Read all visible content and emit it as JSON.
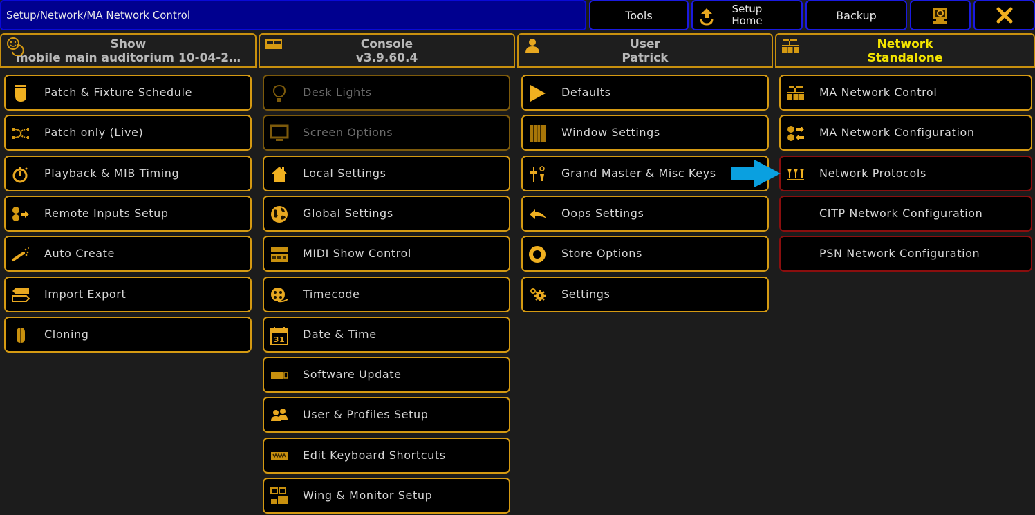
{
  "title_bar": {
    "path": "Setup/Network/MA Network Control"
  },
  "top_buttons": {
    "tools": "Tools",
    "setup_home_line1": "Setup",
    "setup_home_line2": "Home",
    "backup": "Backup",
    "screen_icon": "screen-capture-icon",
    "close_icon": "close-icon"
  },
  "headers": [
    {
      "title": "Show",
      "value": "mobile main auditorium 10-04-2…",
      "icon": "masks-icon",
      "active": false
    },
    {
      "title": "Console",
      "value": "v3.9.60.4",
      "icon": "console-icon",
      "active": false
    },
    {
      "title": "User",
      "value": "Patrick",
      "icon": "user-icon",
      "active": false
    },
    {
      "title": "Network",
      "value": "Standalone",
      "icon": "network-icon",
      "active": true
    }
  ],
  "columns": {
    "show": [
      {
        "label": "Patch & Fixture Schedule",
        "icon": "fixture-icon"
      },
      {
        "label": "Patch only (Live)",
        "icon": "patch-cross-icon"
      },
      {
        "label": "Playback & MIB Timing",
        "icon": "stopwatch-icon"
      },
      {
        "label": "Remote Inputs Setup",
        "icon": "remote-inputs-icon"
      },
      {
        "label": "Auto Create",
        "icon": "magic-wand-icon"
      },
      {
        "label": "Import Export",
        "icon": "import-export-icon"
      },
      {
        "label": "Cloning",
        "icon": "cloning-icon"
      }
    ],
    "console": [
      {
        "label": "Desk Lights",
        "icon": "lightbulb-icon",
        "disabled": true
      },
      {
        "label": "Screen Options",
        "icon": "monitor-icon",
        "disabled": true
      },
      {
        "label": "Local Settings",
        "icon": "home-icon"
      },
      {
        "label": "Global Settings",
        "icon": "globe-icon"
      },
      {
        "label": "MIDI Show Control",
        "icon": "midi-icon"
      },
      {
        "label": "Timecode",
        "icon": "film-reel-icon"
      },
      {
        "label": "Date & Time",
        "icon": "calendar-icon",
        "calendar_day": "31"
      },
      {
        "label": "Software Update",
        "icon": "usb-icon"
      },
      {
        "label": "User & Profiles Setup",
        "icon": "users-icon"
      },
      {
        "label": "Edit Keyboard Shortcuts",
        "icon": "keyboard-icon"
      },
      {
        "label": "Wing & Monitor Setup",
        "icon": "wing-monitor-icon"
      }
    ],
    "user": [
      {
        "label": "Defaults",
        "icon": "play-triangle-icon"
      },
      {
        "label": "Window Settings",
        "icon": "window-columns-icon"
      },
      {
        "label": "Grand Master & Misc Keys",
        "icon": "fader-key-icon"
      },
      {
        "label": "Oops Settings",
        "icon": "undo-arrow-icon"
      },
      {
        "label": "Store Options",
        "icon": "ring-icon"
      },
      {
        "label": "Settings",
        "icon": "gears-icon"
      }
    ],
    "network": [
      {
        "label": "MA Network Control",
        "icon": "network-icon"
      },
      {
        "label": "MA Network Configuration",
        "icon": "network-config-icon"
      },
      {
        "label": "Network Protocols",
        "icon": "protocols-icon",
        "highlight": "red"
      },
      {
        "label": "CITP Network Configuration",
        "icon": "",
        "highlight": "red"
      },
      {
        "label": "PSN Network Configuration",
        "icon": "",
        "highlight": "red"
      }
    ]
  },
  "annotation": {
    "arrow_color": "#0aa0e0",
    "points_to": "Network Protocols"
  },
  "colors": {
    "title_bg": "#00008f",
    "title_border": "#0a0ad8",
    "accent": "#d59a12",
    "active_header_text": "#f4e400",
    "red_border": "#8a0e0e",
    "icon": "#e8a820"
  }
}
